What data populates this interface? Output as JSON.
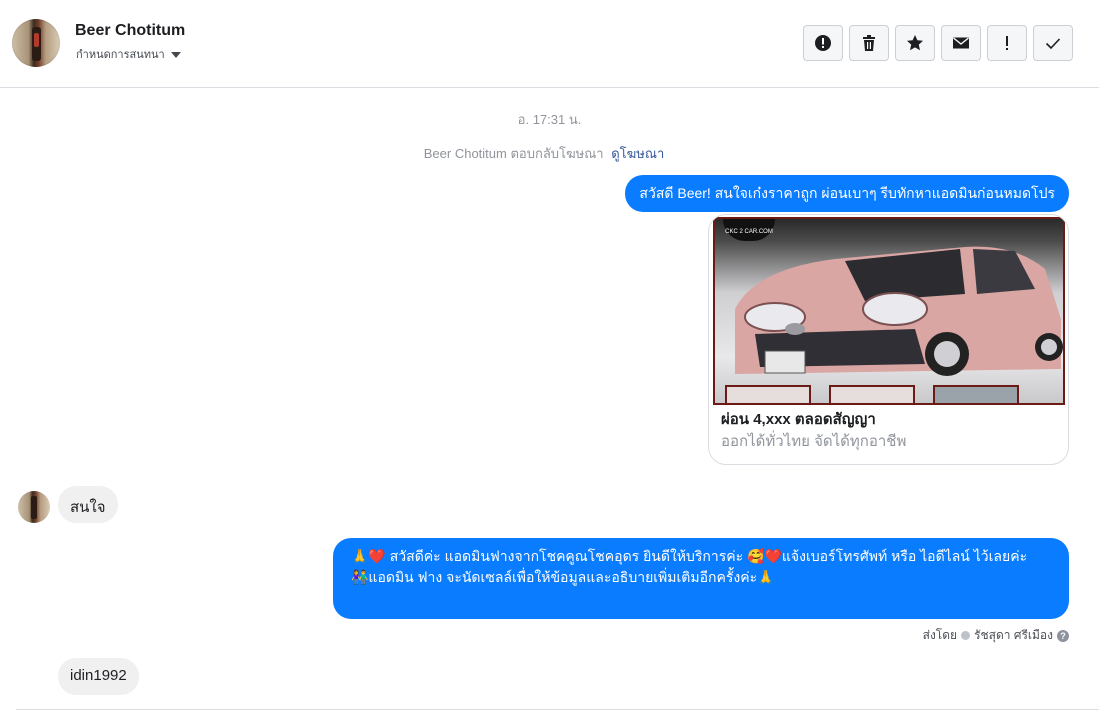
{
  "header": {
    "contact_name": "Beer Chotitum",
    "subtitle": "กำหนดการสนทนา",
    "actions": [
      {
        "name": "report-button",
        "icon": "alert-circle-icon"
      },
      {
        "name": "delete-button",
        "icon": "trash-icon"
      },
      {
        "name": "star-button",
        "icon": "star-icon"
      },
      {
        "name": "mark-unread-button",
        "icon": "envelope-icon"
      },
      {
        "name": "mark-important-button",
        "icon": "exclamation-icon"
      },
      {
        "name": "mark-done-button",
        "icon": "checkmark-icon"
      }
    ]
  },
  "conversation": {
    "timestamp": "อ. 17:31 น.",
    "ad_reply_text": "Beer Chotitum ตอบกลับโฆษณา",
    "ad_link": "ดูโฆษณา",
    "messages": {
      "out1": "สวัสดี Beer! สนใจเก๋งราคาถูก ผ่อนเบาๆ รีบทักหาแอดมินก่อนหมดโปร",
      "card_title": "ผ่อน 4,xxx ตลอดสัญญา",
      "card_subtitle": "ออกได้ทั่วไทย จัดได้ทุกอาชีพ",
      "card_logo": "CKC 2 CAR.COM",
      "in1": "สนใจ",
      "out2_line1": "🙏❤️ สวัสดีค่ะ แอดมินฟางจากโชคคูณโชคอุดร ยินดีให้บริการค่ะ  🥰❤️แจ้งเบอร์โทรศัพท์ หรือ ไอดีไลน์  ไว้เลยค่ะ",
      "out2_line2": "👫แอดมิน ฟาง จะนัดเซลล์เพื่อให้ข้อมูลและอธิบายเพิ่มเติมอีกครั้งค่ะ🙏",
      "sent_by_label": "ส่งโดย",
      "sent_by_name": "รัชสุดา ศรีเมือง",
      "in2": "idin1992"
    }
  },
  "colors": {
    "outgoing_bubble": "#0a7cff",
    "incoming_bubble": "#f1f0f0",
    "link": "#365899"
  }
}
